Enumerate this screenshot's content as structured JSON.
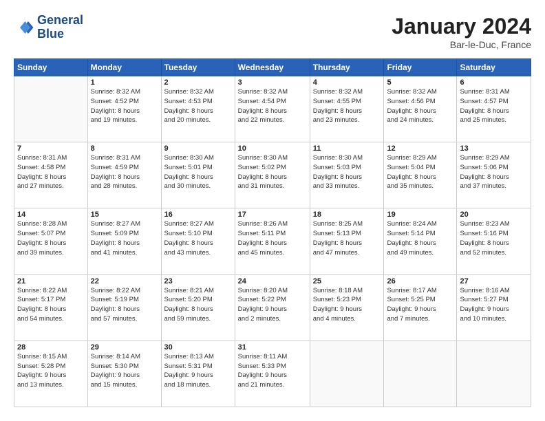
{
  "header": {
    "logo_line1": "General",
    "logo_line2": "Blue",
    "month": "January 2024",
    "location": "Bar-le-Duc, France"
  },
  "days_of_week": [
    "Sunday",
    "Monday",
    "Tuesday",
    "Wednesday",
    "Thursday",
    "Friday",
    "Saturday"
  ],
  "weeks": [
    [
      {
        "day": "",
        "info": ""
      },
      {
        "day": "1",
        "info": "Sunrise: 8:32 AM\nSunset: 4:52 PM\nDaylight: 8 hours\nand 19 minutes."
      },
      {
        "day": "2",
        "info": "Sunrise: 8:32 AM\nSunset: 4:53 PM\nDaylight: 8 hours\nand 20 minutes."
      },
      {
        "day": "3",
        "info": "Sunrise: 8:32 AM\nSunset: 4:54 PM\nDaylight: 8 hours\nand 22 minutes."
      },
      {
        "day": "4",
        "info": "Sunrise: 8:32 AM\nSunset: 4:55 PM\nDaylight: 8 hours\nand 23 minutes."
      },
      {
        "day": "5",
        "info": "Sunrise: 8:32 AM\nSunset: 4:56 PM\nDaylight: 8 hours\nand 24 minutes."
      },
      {
        "day": "6",
        "info": "Sunrise: 8:31 AM\nSunset: 4:57 PM\nDaylight: 8 hours\nand 25 minutes."
      }
    ],
    [
      {
        "day": "7",
        "info": "Sunrise: 8:31 AM\nSunset: 4:58 PM\nDaylight: 8 hours\nand 27 minutes."
      },
      {
        "day": "8",
        "info": "Sunrise: 8:31 AM\nSunset: 4:59 PM\nDaylight: 8 hours\nand 28 minutes."
      },
      {
        "day": "9",
        "info": "Sunrise: 8:30 AM\nSunset: 5:01 PM\nDaylight: 8 hours\nand 30 minutes."
      },
      {
        "day": "10",
        "info": "Sunrise: 8:30 AM\nSunset: 5:02 PM\nDaylight: 8 hours\nand 31 minutes."
      },
      {
        "day": "11",
        "info": "Sunrise: 8:30 AM\nSunset: 5:03 PM\nDaylight: 8 hours\nand 33 minutes."
      },
      {
        "day": "12",
        "info": "Sunrise: 8:29 AM\nSunset: 5:04 PM\nDaylight: 8 hours\nand 35 minutes."
      },
      {
        "day": "13",
        "info": "Sunrise: 8:29 AM\nSunset: 5:06 PM\nDaylight: 8 hours\nand 37 minutes."
      }
    ],
    [
      {
        "day": "14",
        "info": "Sunrise: 8:28 AM\nSunset: 5:07 PM\nDaylight: 8 hours\nand 39 minutes."
      },
      {
        "day": "15",
        "info": "Sunrise: 8:27 AM\nSunset: 5:09 PM\nDaylight: 8 hours\nand 41 minutes."
      },
      {
        "day": "16",
        "info": "Sunrise: 8:27 AM\nSunset: 5:10 PM\nDaylight: 8 hours\nand 43 minutes."
      },
      {
        "day": "17",
        "info": "Sunrise: 8:26 AM\nSunset: 5:11 PM\nDaylight: 8 hours\nand 45 minutes."
      },
      {
        "day": "18",
        "info": "Sunrise: 8:25 AM\nSunset: 5:13 PM\nDaylight: 8 hours\nand 47 minutes."
      },
      {
        "day": "19",
        "info": "Sunrise: 8:24 AM\nSunset: 5:14 PM\nDaylight: 8 hours\nand 49 minutes."
      },
      {
        "day": "20",
        "info": "Sunrise: 8:23 AM\nSunset: 5:16 PM\nDaylight: 8 hours\nand 52 minutes."
      }
    ],
    [
      {
        "day": "21",
        "info": "Sunrise: 8:22 AM\nSunset: 5:17 PM\nDaylight: 8 hours\nand 54 minutes."
      },
      {
        "day": "22",
        "info": "Sunrise: 8:22 AM\nSunset: 5:19 PM\nDaylight: 8 hours\nand 57 minutes."
      },
      {
        "day": "23",
        "info": "Sunrise: 8:21 AM\nSunset: 5:20 PM\nDaylight: 8 hours\nand 59 minutes."
      },
      {
        "day": "24",
        "info": "Sunrise: 8:20 AM\nSunset: 5:22 PM\nDaylight: 9 hours\nand 2 minutes."
      },
      {
        "day": "25",
        "info": "Sunrise: 8:18 AM\nSunset: 5:23 PM\nDaylight: 9 hours\nand 4 minutes."
      },
      {
        "day": "26",
        "info": "Sunrise: 8:17 AM\nSunset: 5:25 PM\nDaylight: 9 hours\nand 7 minutes."
      },
      {
        "day": "27",
        "info": "Sunrise: 8:16 AM\nSunset: 5:27 PM\nDaylight: 9 hours\nand 10 minutes."
      }
    ],
    [
      {
        "day": "28",
        "info": "Sunrise: 8:15 AM\nSunset: 5:28 PM\nDaylight: 9 hours\nand 13 minutes."
      },
      {
        "day": "29",
        "info": "Sunrise: 8:14 AM\nSunset: 5:30 PM\nDaylight: 9 hours\nand 15 minutes."
      },
      {
        "day": "30",
        "info": "Sunrise: 8:13 AM\nSunset: 5:31 PM\nDaylight: 9 hours\nand 18 minutes."
      },
      {
        "day": "31",
        "info": "Sunrise: 8:11 AM\nSunset: 5:33 PM\nDaylight: 9 hours\nand 21 minutes."
      },
      {
        "day": "",
        "info": ""
      },
      {
        "day": "",
        "info": ""
      },
      {
        "day": "",
        "info": ""
      }
    ]
  ]
}
